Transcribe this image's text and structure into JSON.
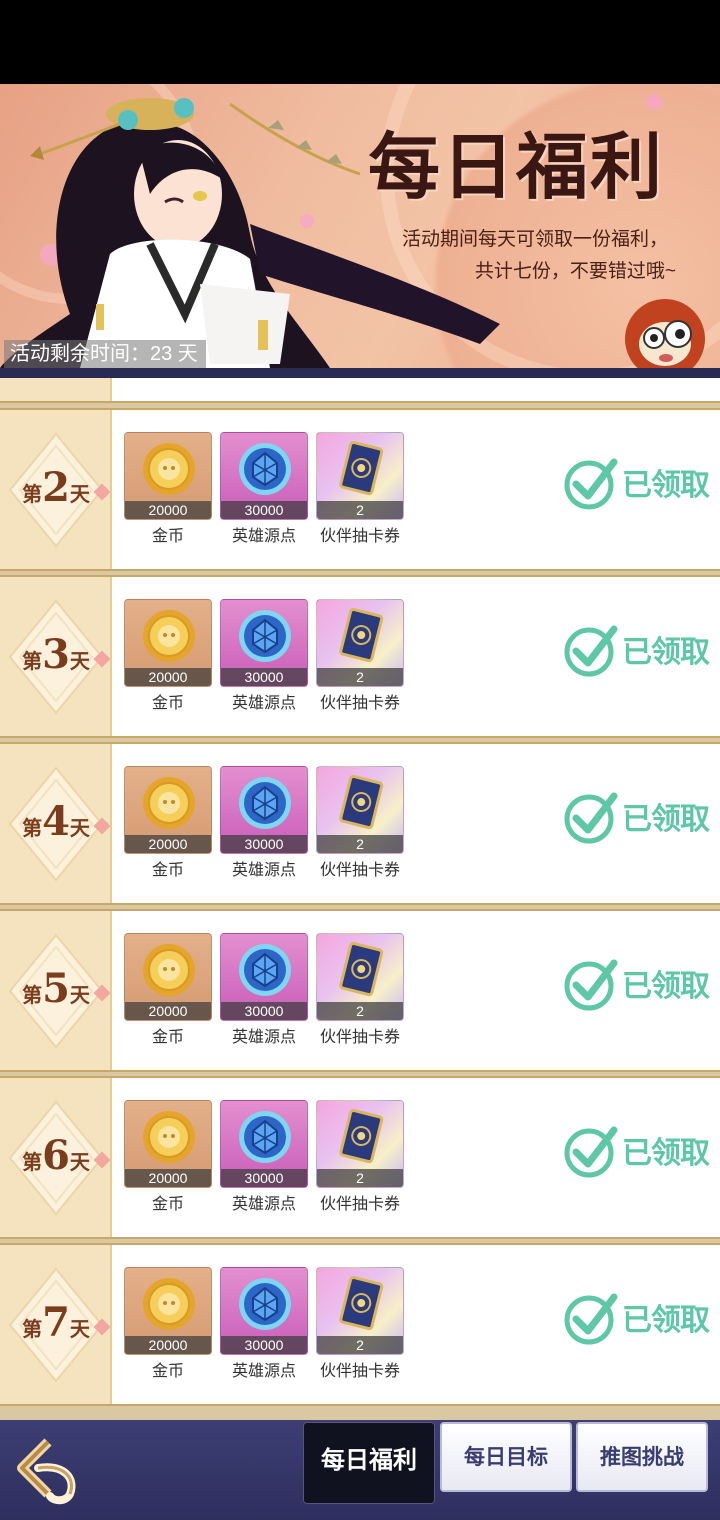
{
  "banner": {
    "title": "每日福利",
    "desc_line1": "活动期间每天可领取一份福利，",
    "desc_line2": "共计七份，不要错过哦~",
    "timer": "活动剩余时间：23 天"
  },
  "rows": [
    {
      "day_prefix": "第",
      "day_num": "2",
      "day_suffix": "天",
      "status": "已领取",
      "rewards": [
        {
          "qty": "20000",
          "name": "金币"
        },
        {
          "qty": "30000",
          "name": "英雄源点"
        },
        {
          "qty": "2",
          "name": "伙伴抽卡券"
        }
      ]
    },
    {
      "day_prefix": "第",
      "day_num": "3",
      "day_suffix": "天",
      "status": "已领取",
      "rewards": [
        {
          "qty": "20000",
          "name": "金币"
        },
        {
          "qty": "30000",
          "name": "英雄源点"
        },
        {
          "qty": "2",
          "name": "伙伴抽卡券"
        }
      ]
    },
    {
      "day_prefix": "第",
      "day_num": "4",
      "day_suffix": "天",
      "status": "已领取",
      "rewards": [
        {
          "qty": "20000",
          "name": "金币"
        },
        {
          "qty": "30000",
          "name": "英雄源点"
        },
        {
          "qty": "2",
          "name": "伙伴抽卡券"
        }
      ]
    },
    {
      "day_prefix": "第",
      "day_num": "5",
      "day_suffix": "天",
      "status": "已领取",
      "rewards": [
        {
          "qty": "20000",
          "name": "金币"
        },
        {
          "qty": "30000",
          "name": "英雄源点"
        },
        {
          "qty": "2",
          "name": "伙伴抽卡券"
        }
      ]
    },
    {
      "day_prefix": "第",
      "day_num": "6",
      "day_suffix": "天",
      "status": "已领取",
      "rewards": [
        {
          "qty": "20000",
          "name": "金币"
        },
        {
          "qty": "30000",
          "name": "英雄源点"
        },
        {
          "qty": "2",
          "name": "伙伴抽卡券"
        }
      ]
    },
    {
      "day_prefix": "第",
      "day_num": "7",
      "day_suffix": "天",
      "status": "已领取",
      "rewards": [
        {
          "qty": "20000",
          "name": "金币"
        },
        {
          "qty": "30000",
          "name": "英雄源点"
        },
        {
          "qty": "2",
          "name": "伙伴抽卡券"
        }
      ]
    }
  ],
  "tabs": {
    "daily_welfare": "每日福利",
    "daily_goal": "每日目标",
    "push_challenge": "推图挑战"
  },
  "colors": {
    "claimed_green": "#5dc7a6",
    "day_brown": "#7a3c1c",
    "bar_navy": "#2e2f5e"
  }
}
